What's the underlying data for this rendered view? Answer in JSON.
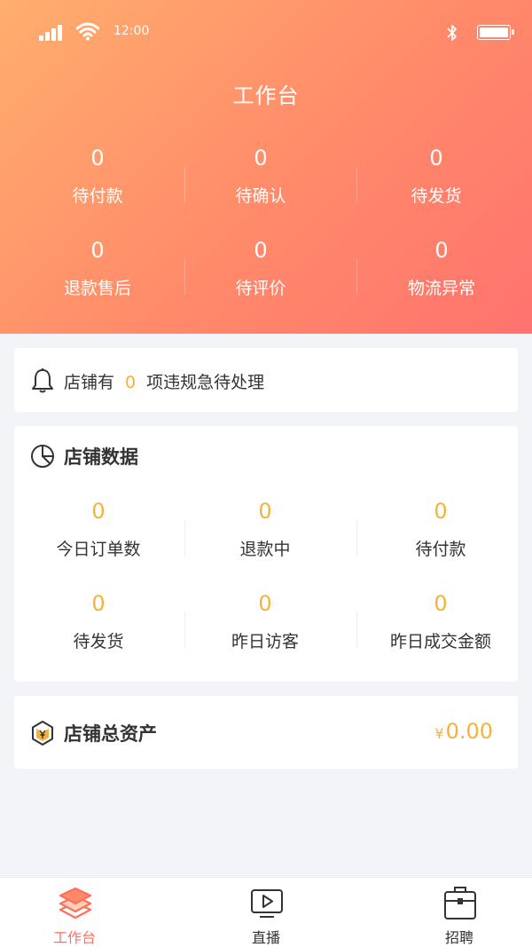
{
  "status_bar": {
    "time": "12:00"
  },
  "header": {
    "title": "工作台",
    "stats": [
      {
        "value": "0",
        "label": "待付款"
      },
      {
        "value": "0",
        "label": "待确认"
      },
      {
        "value": "0",
        "label": "待发货"
      },
      {
        "value": "0",
        "label": "退款售后"
      },
      {
        "value": "0",
        "label": "待评价"
      },
      {
        "value": "0",
        "label": "物流异常"
      }
    ]
  },
  "alert": {
    "prefix": "店铺有",
    "count": "0",
    "suffix": "项违规急待处理"
  },
  "store_data": {
    "title": "店铺数据",
    "stats": [
      {
        "value": "0",
        "label": "今日订单数"
      },
      {
        "value": "0",
        "label": "退款中"
      },
      {
        "value": "0",
        "label": "待付款"
      },
      {
        "value": "0",
        "label": "待发货"
      },
      {
        "value": "0",
        "label": "昨日访客"
      },
      {
        "value": "0",
        "label": "昨日成交金额"
      }
    ]
  },
  "assets": {
    "title": "店铺总资产",
    "currency": "¥",
    "amount": "0.00"
  },
  "tabbar": {
    "items": [
      {
        "label": "工作台",
        "icon": "layers-icon"
      },
      {
        "label": "直播",
        "icon": "play-icon"
      },
      {
        "label": "招聘",
        "icon": "briefcase-icon"
      }
    ]
  },
  "colors": {
    "accent": "#ff6f5a",
    "value_highlight": "#f5b23b",
    "header_from": "#ffae6e",
    "header_to": "#ff736e"
  }
}
